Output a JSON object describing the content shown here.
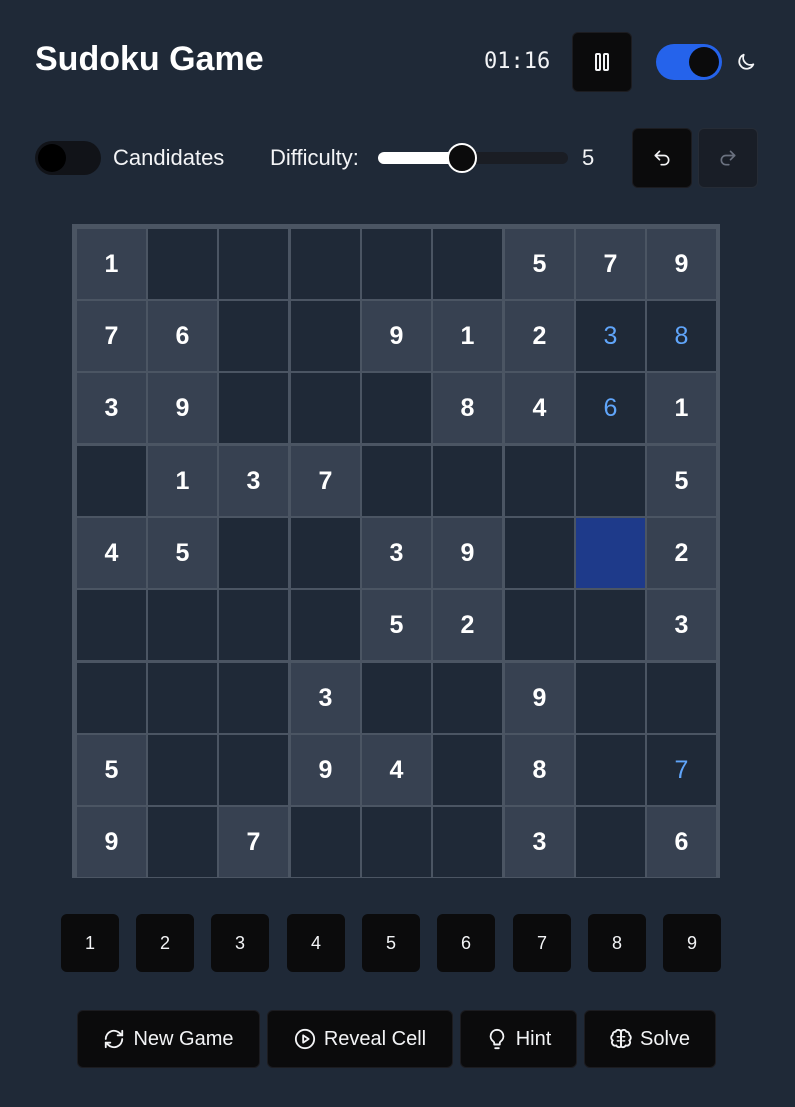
{
  "header": {
    "title": "Sudoku Game",
    "timer": "01:16",
    "pause_icon": "pause-icon",
    "theme_toggle_on": true,
    "theme_icon": "moon-icon"
  },
  "controls": {
    "candidates_label": "Candidates",
    "candidates_on": false,
    "difficulty_label": "Difficulty:",
    "difficulty_value": "5",
    "difficulty_min": 1,
    "difficulty_max": 10,
    "undo_icon": "undo-icon",
    "redo_icon": "redo-icon"
  },
  "board": {
    "cells": [
      [
        "1",
        "",
        "",
        "",
        "",
        "",
        "5",
        "7",
        "9"
      ],
      [
        "7",
        "6",
        "",
        "",
        "9",
        "1",
        "2",
        "3",
        "8"
      ],
      [
        "3",
        "9",
        "",
        "",
        "",
        "8",
        "4",
        "6",
        "1"
      ],
      [
        "",
        "1",
        "3",
        "7",
        "",
        "",
        "",
        "",
        "5"
      ],
      [
        "4",
        "5",
        "",
        "",
        "3",
        "9",
        "",
        "",
        "2"
      ],
      [
        "",
        "",
        "",
        "",
        "5",
        "2",
        "",
        "",
        "3"
      ],
      [
        "",
        "",
        "",
        "3",
        "",
        "",
        "9",
        "",
        ""
      ],
      [
        "5",
        "",
        "",
        "9",
        "4",
        "",
        "8",
        "",
        "7"
      ],
      [
        "9",
        "",
        "7",
        "",
        "",
        "",
        "3",
        "",
        "6"
      ]
    ],
    "user_entries": [
      [
        1,
        7
      ],
      [
        1,
        8
      ],
      [
        2,
        7
      ],
      [
        7,
        8
      ]
    ],
    "selected": [
      4,
      7
    ],
    "colors": {
      "given_bg": "#374151",
      "empty_bg": "#1f2937",
      "entry_text": "#60a5fa",
      "selected_bg": "#1e3a8a"
    }
  },
  "numpad": [
    "1",
    "2",
    "3",
    "4",
    "5",
    "6",
    "7",
    "8",
    "9"
  ],
  "actions": [
    {
      "label": "New Game",
      "icon": "refresh-icon"
    },
    {
      "label": "Reveal Cell",
      "icon": "play-circle-icon"
    },
    {
      "label": "Hint",
      "icon": "lightbulb-icon"
    },
    {
      "label": "Solve",
      "icon": "brain-icon"
    }
  ]
}
